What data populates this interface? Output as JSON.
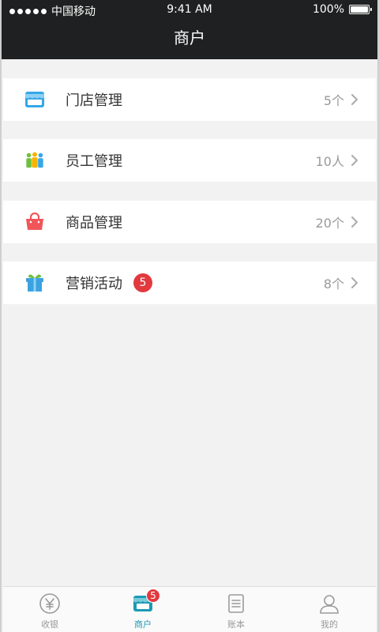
{
  "status_bar": {
    "carrier": "中国移动",
    "time": "9:41 AM",
    "battery": "100%"
  },
  "header": {
    "title": "商户"
  },
  "rows": [
    {
      "label": "门店管理",
      "value": "5个",
      "icon": "store-icon",
      "color": "#35a7e8"
    },
    {
      "label": "员工管理",
      "value": "10人",
      "icon": "staff-icon",
      "color": "#f4b400"
    },
    {
      "label": "商品管理",
      "value": "20个",
      "icon": "shopping-bag-icon",
      "color": "#f0555a"
    },
    {
      "label": "营销活动",
      "badge": "5",
      "value": "8个",
      "icon": "gift-icon",
      "color": "#3aa2e0"
    }
  ],
  "tabbar": {
    "tabs": [
      {
        "label": "收银",
        "icon": "yen-icon",
        "active": false
      },
      {
        "label": "商户",
        "icon": "store-icon",
        "active": true,
        "badge": "5"
      },
      {
        "label": "账本",
        "icon": "ledger-icon",
        "active": false
      },
      {
        "label": "我的",
        "icon": "user-icon",
        "active": false
      }
    ],
    "accent": "#1b9ab5"
  }
}
